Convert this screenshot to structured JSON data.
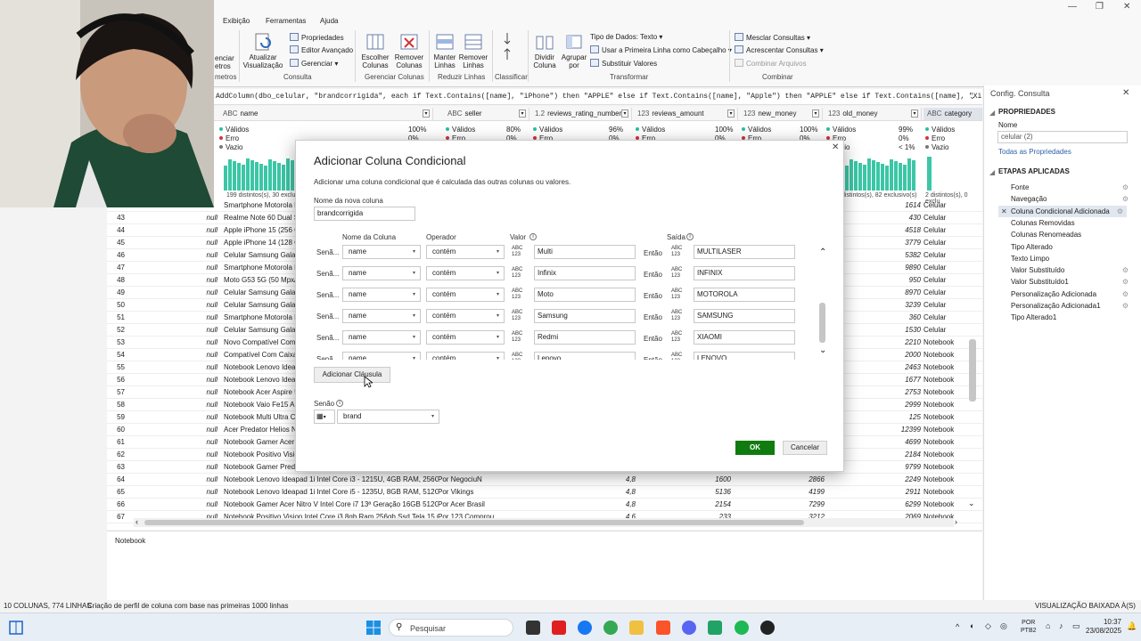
{
  "menu": [
    "Exibição",
    "Ferramentas",
    "Ajuda"
  ],
  "ribbon": {
    "partial_left_1": "enciar",
    "partial_left_2": "etros",
    "partial_group": "metros",
    "propriedades": "Propriedades",
    "editor_avancado": "Editor Avançado",
    "gerenciar": "Gerenciar",
    "atualizar": "Atualizar Visualização",
    "group_consulta": "Consulta",
    "escolher_colunas": "Escolher Colunas",
    "remover_colunas": "Remover Colunas",
    "group_gerenciar": "Gerenciar Colunas",
    "manter_linhas": "Manter Linhas",
    "remover_linhas": "Remover Linhas",
    "group_reduzir": "Reduzir Linhas",
    "group_classificar": "Classificar",
    "dividir_coluna": "Dividir Coluna",
    "agrupar_por": "Agrupar por",
    "tipo_dados": "Tipo de Dados: Texto",
    "usar_primeira": "Usar a Primeira Linha como Cabeçalho",
    "substituir": "Substituir Valores",
    "group_transformar": "Transformar",
    "mesclar": "Mesclar Consultas",
    "acrescentar": "Acrescentar Consultas",
    "combinar_arquivos": "Combinar Arquivos",
    "group_combinar": "Combinar"
  },
  "formula": "AddColumn(dbo_celular, \"brandcorrigida\", each if Text.Contains([name], \"iPhone\") then \"APPLE\" else if Text.Contains([name], \"Apple\") then \"APPLE\" else if Text.Contains([name], \"Xiaomi\") then",
  "grid": {
    "columns": [
      {
        "type": "ABC",
        "name": "name"
      },
      {
        "type": "ABC",
        "name": "seller"
      },
      {
        "type": "1.2",
        "name": "reviews_rating_number"
      },
      {
        "type": "123",
        "name": "reviews_amount"
      },
      {
        "type": "123",
        "name": "new_money"
      },
      {
        "type": "123",
        "name": "old_money"
      },
      {
        "type": "ABC",
        "name": "category"
      }
    ],
    "quality": [
      {
        "valid": "100%",
        "error": "0%"
      },
      {
        "valid": "80%",
        "error": "0%"
      },
      {
        "valid": "96%",
        "error": "0%"
      },
      {
        "valid": "100%",
        "error": "0%"
      },
      {
        "valid": "100%",
        "error": "0%"
      },
      {
        "valid": "99%",
        "error": "0%",
        "empty": "< 1%"
      }
    ],
    "quality_labels": {
      "valid": "Válidos",
      "error": "Erro",
      "empty": "Vazio"
    },
    "distinct_first": "199 distintos(s), 30 exclus",
    "distinct_old": "distintos(s), 82 exclusivo(s)",
    "distinct_cat": "2 distintos(s), 0 exclu",
    "rows": [
      {
        "n": "",
        "nul": "",
        "name": "Smartphone Motorola E",
        "seller": "",
        "rating": "",
        "amount": "",
        "new": "",
        "old": "1614",
        "cat": "Celular"
      },
      {
        "n": "43",
        "nul": "null",
        "name": "Realme Note 60 Dual Sin",
        "seller": "",
        "rating": "",
        "amount": "",
        "new": "",
        "old": "430",
        "cat": "Celular"
      },
      {
        "n": "44",
        "nul": "null",
        "name": "Apple iPhone 15 (256 GB",
        "seller": "",
        "rating": "",
        "amount": "",
        "new": "",
        "old": "4518",
        "cat": "Celular"
      },
      {
        "n": "45",
        "nul": "null",
        "name": "Apple iPhone 14 (128 GB",
        "seller": "",
        "rating": "",
        "amount": "",
        "new": "",
        "old": "3779",
        "cat": "Celular"
      },
      {
        "n": "46",
        "nul": "null",
        "name": "Celular Samsung Galaxy",
        "seller": "",
        "rating": "",
        "amount": "",
        "new": "",
        "old": "5382",
        "cat": "Celular"
      },
      {
        "n": "47",
        "nul": "null",
        "name": "Smartphone Motorola M",
        "seller": "",
        "rating": "",
        "amount": "",
        "new": "",
        "old": "9890",
        "cat": "Celular"
      },
      {
        "n": "48",
        "nul": "null",
        "name": "Moto G53 5G (50 Mpx/2",
        "seller": "",
        "rating": "",
        "amount": "",
        "new": "",
        "old": "950",
        "cat": "Celular"
      },
      {
        "n": "49",
        "nul": "null",
        "name": "Celular Samsung Galaxy",
        "seller": "",
        "rating": "",
        "amount": "",
        "new": "",
        "old": "8970",
        "cat": "Celular"
      },
      {
        "n": "50",
        "nul": "null",
        "name": "Celular Samsung Galaxy",
        "seller": "",
        "rating": "",
        "amount": "",
        "new": "",
        "old": "3239",
        "cat": "Celular"
      },
      {
        "n": "51",
        "nul": "null",
        "name": "Smartphone Motorola M",
        "seller": "",
        "rating": "",
        "amount": "",
        "new": "",
        "old": "360",
        "cat": "Celular"
      },
      {
        "n": "52",
        "nul": "null",
        "name": "Celular Samsung Galaxy",
        "seller": "",
        "rating": "",
        "amount": "",
        "new": "",
        "old": "1530",
        "cat": "Celular"
      },
      {
        "n": "53",
        "nul": "null",
        "name": "Novo Compatível Com Pr",
        "seller": "",
        "rating": "",
        "amount": "",
        "new": "",
        "old": "2210",
        "cat": "Notebook"
      },
      {
        "n": "54",
        "nul": "null",
        "name": "Compatível Com Caixa M",
        "seller": "",
        "rating": "",
        "amount": "",
        "new": "",
        "old": "2000",
        "cat": "Notebook"
      },
      {
        "n": "55",
        "nul": "null",
        "name": "Notebook Lenovo Ideapa",
        "seller": "",
        "rating": "",
        "amount": "",
        "new": "",
        "old": "2463",
        "cat": "Notebook"
      },
      {
        "n": "56",
        "nul": "null",
        "name": "Notebook Lenovo Ideapa",
        "seller": "",
        "rating": "",
        "amount": "",
        "new": "",
        "old": "1677",
        "cat": "Notebook"
      },
      {
        "n": "57",
        "nul": "null",
        "name": "Notebook Acer Aspire 5",
        "seller": "",
        "rating": "",
        "amount": "",
        "new": "",
        "old": "2753",
        "cat": "Notebook"
      },
      {
        "n": "58",
        "nul": "null",
        "name": "Notebook Vaio Fe15 Amc",
        "seller": "",
        "rating": "",
        "amount": "",
        "new": "",
        "old": "2999",
        "cat": "Notebook"
      },
      {
        "n": "59",
        "nul": "null",
        "name": "Notebook Multi Ultra Ce",
        "seller": "",
        "rating": "",
        "amount": "",
        "new": "",
        "old": "125",
        "cat": "Notebook"
      },
      {
        "n": "60",
        "nul": "null",
        "name": "Acer Predator Helios Neo",
        "seller": "",
        "rating": "",
        "amount": "",
        "new": "",
        "old": "12399",
        "cat": "Notebook"
      },
      {
        "n": "61",
        "nul": "null",
        "name": "Notebook Gamer Acer N",
        "seller": "",
        "rating": "",
        "amount": "",
        "new": "",
        "old": "4699",
        "cat": "Notebook"
      },
      {
        "n": "62",
        "nul": "null",
        "name": "Notebook Positivo Visio",
        "seller": "",
        "rating": "",
        "amount": "",
        "new": "",
        "old": "2184",
        "cat": "Notebook"
      },
      {
        "n": "63",
        "nul": "null",
        "name": "Notebook Gamer Predat",
        "seller": "",
        "rating": "",
        "amount": "",
        "new": "",
        "old": "9799",
        "cat": "Notebook"
      },
      {
        "n": "64",
        "nul": "null",
        "name": "Notebook Lenovo Ideapad 1i Intel Core i3 - 1215U, 4GB RAM, 256GB S",
        "seller": "Por NegociuN",
        "rating": "4,8",
        "amount": "1600",
        "new": "2866",
        "old": "2249",
        "cat": "Notebook"
      },
      {
        "n": "65",
        "nul": "null",
        "name": "Notebook Lenovo Ideapad 1i Intel Core i5 - 1235U, 8GB RAM, 512GB S",
        "seller": "Por Vikings",
        "rating": "4,8",
        "amount": "5136",
        "new": "4199",
        "old": "2911",
        "cat": "Notebook"
      },
      {
        "n": "66",
        "nul": "null",
        "name": "Notebook Gamer Acer Nitro V Intel Core i7 13ª Geração 16GB 512GB R...",
        "seller": "Por Acer Brasil",
        "rating": "4,8",
        "amount": "2154",
        "new": "7299",
        "old": "6299",
        "cat": "Notebook"
      },
      {
        "n": "67",
        "nul": "null",
        "name": "Notebook Positivo Vision Intel Core i3 8gb Ram 256gb Ssd Tela 15,6\" F",
        "seller": "Por 123 Comprou",
        "rating": "4,6",
        "amount": "233",
        "new": "3212",
        "old": "2069",
        "cat": "Notebook"
      }
    ]
  },
  "preview_cell": "Notebook",
  "rpanel": {
    "title": "Config. Consulta",
    "props_header": "PROPRIEDADES",
    "name_label": "Nome",
    "name_value": "celular (2)",
    "all_props": "Todas as Propriedades",
    "steps_header": "ETAPAS APLICADAS",
    "steps": [
      {
        "label": "Fonte",
        "gear": true
      },
      {
        "label": "Navegação",
        "gear": true
      },
      {
        "label": "Coluna Condicional Adicionada",
        "gear": true,
        "selected": true
      },
      {
        "label": "Colunas Removidas",
        "gear": false
      },
      {
        "label": "Colunas Renomeadas",
        "gear": false
      },
      {
        "label": "Tipo Alterado",
        "gear": false
      },
      {
        "label": "Texto Limpo",
        "gear": false
      },
      {
        "label": "Valor Substituído",
        "gear": true
      },
      {
        "label": "Valor Substituído1",
        "gear": true
      },
      {
        "label": "Personalização Adicionada",
        "gear": true
      },
      {
        "label": "Personalização Adicionada1",
        "gear": true
      },
      {
        "label": "Tipo Alterado1",
        "gear": false
      }
    ]
  },
  "dialog": {
    "title": "Adicionar Coluna Condicional",
    "subtitle": "Adicionar uma coluna condicional que é calculada das outras colunas ou valores.",
    "new_col_label": "Nome da nova coluna",
    "new_col_value": "brandcorrigida",
    "hdr_col": "Nome da Coluna",
    "hdr_op": "Operador",
    "hdr_val": "Valor",
    "hdr_out": "Saída",
    "clauses": [
      {
        "prefix": "Senã...",
        "col": "name",
        "op": "contém",
        "val": "Multi",
        "then": "Então",
        "out": "MULTILASER"
      },
      {
        "prefix": "Senã...",
        "col": "name",
        "op": "contém",
        "val": "Infinix",
        "then": "Então",
        "out": "INFINIX"
      },
      {
        "prefix": "Senã...",
        "col": "name",
        "op": "contém",
        "val": "Moto",
        "then": "Então",
        "out": "MOTOROLA"
      },
      {
        "prefix": "Senã...",
        "col": "name",
        "op": "contém",
        "val": "Samsung",
        "then": "Então",
        "out": "SAMSUNG"
      },
      {
        "prefix": "Senã...",
        "col": "name",
        "op": "contém",
        "val": "Redmi",
        "then": "Então",
        "out": "XIAOMI"
      },
      {
        "prefix": "Senã...",
        "col": "name",
        "op": "contém",
        "val": "Lenovo",
        "then": "Então",
        "out": "LENOVO"
      }
    ],
    "type_badge": "ABC 123",
    "add_clause": "Adicionar Cláusula",
    "else_label": "Senão",
    "else_value": "brand",
    "ok": "OK",
    "cancel": "Cancelar"
  },
  "status": {
    "left": "10 COLUNAS, 774 LINHAS",
    "mid": "Criação de perfil de coluna com base nas primeiras 1000 linhas",
    "right": "VISUALIZAÇÃO BAIXADA À(S) 10:36"
  },
  "taskbar": {
    "search": "Pesquisar",
    "lang1": "POR",
    "lang2": "PTB2",
    "time": "10:37",
    "date": "23/08/2025"
  },
  "colors": {
    "accent": "#107c10",
    "selected_step": "#e1e7f0"
  }
}
